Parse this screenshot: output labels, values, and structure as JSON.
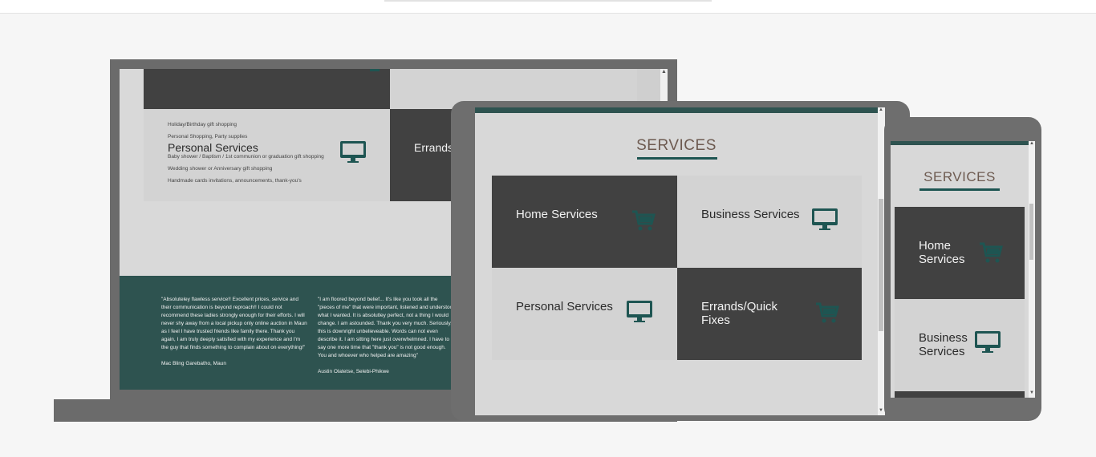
{
  "colors": {
    "accent_teal": "#1e5552",
    "footer_teal": "#2e5350",
    "tile_dark": "#414141",
    "tile_light": "#d3d3d3",
    "title_brown": "#6d5a50",
    "device_gray": "#6e6e6e"
  },
  "laptop": {
    "personal_list_items": [
      "Holiday/Birthday gift shopping",
      "Personal Shopping, Party supplies",
      "Baby shower / Baptism / 1st communion or graduation gift shopping",
      "Wedding shower or Anniversary gift shopping",
      "Handmade cards invitations, announcements, thank-you's"
    ],
    "personal_title": "Personal Services",
    "personal_icon": "monitor-icon",
    "errands_title": "Errands/Quick Fixes",
    "testimonials": [
      {
        "quote": "\"Absoluteley flawless service!! Excellent prices, service and their communication is beyond reproach!! I could not recommend these ladies strongly enough for their efforts. I will never shy away from a local pickup only online auction in Maun as I feel I have trusted friends like family there. Thank you again, I am truly deeply satisfied with my experience and I'm the guy that finds something to complain about on everything!\"",
        "author": "Mac Bling Garebatho, Maun"
      },
      {
        "quote": "\"I am floored beyond belief... It's like you took all the \"pieces of me\" that were important, listened and understood what I wanted. It is absolutley perfect, not a thing I would change. I am astounded. Thank you very much. Seriously, this is downright unbelieveable. Words can not even describe it. I am sitting here just overwhelmned. I have to say one more time that \"thank you\" is not good enough. You and whoever who helped are amazing\"",
        "author": "Austin Olatetse, Selebi-Phikwe"
      }
    ]
  },
  "tablet": {
    "section_title": "SERVICES",
    "tiles": [
      {
        "label": "Home Services",
        "icon": "cart-icon"
      },
      {
        "label": "Business Services",
        "icon": "monitor-icon"
      },
      {
        "label": "Personal Services",
        "icon": "monitor-icon"
      },
      {
        "label": "Errands/Quick Fixes",
        "icon": "cart-icon"
      }
    ]
  },
  "phone": {
    "section_title": "SERVICES",
    "tiles": [
      {
        "label": "Home Services",
        "icon": "cart-icon"
      },
      {
        "label": "Business Services",
        "icon": "monitor-icon"
      }
    ]
  }
}
